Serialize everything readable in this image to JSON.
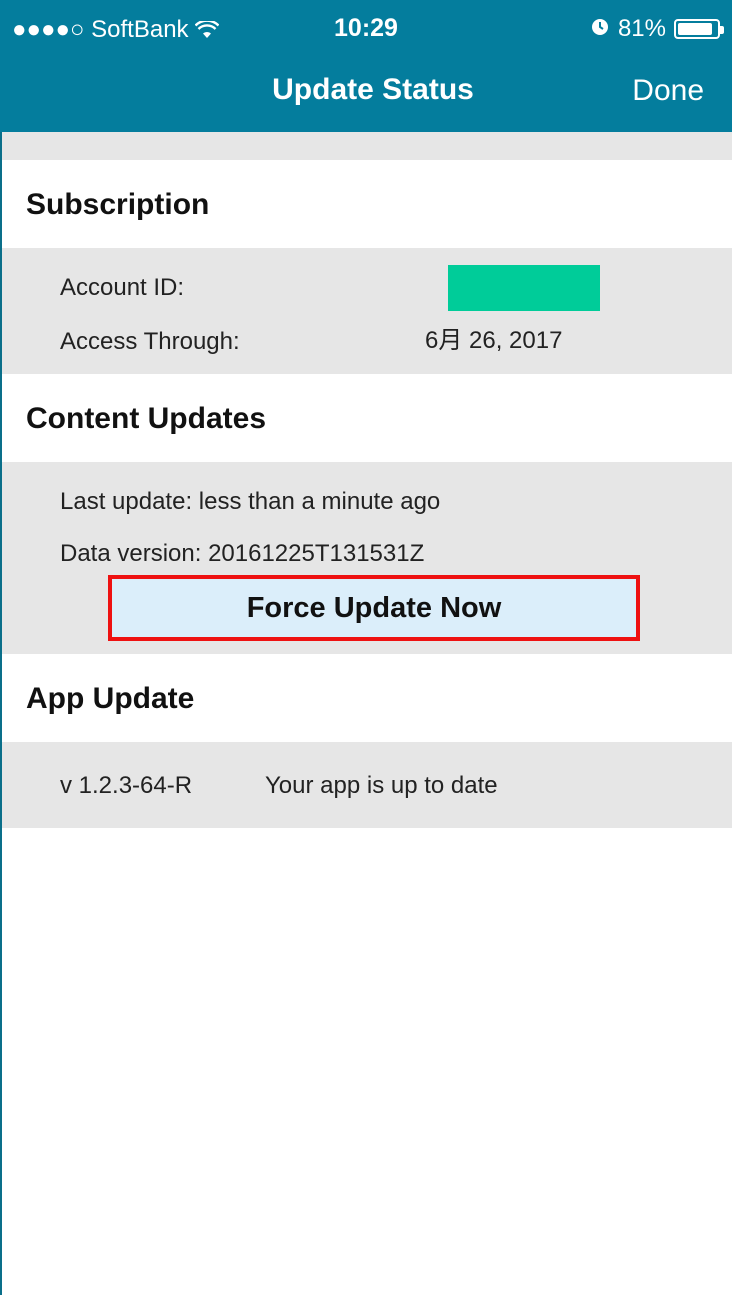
{
  "status_bar": {
    "signal": "●●●●○",
    "carrier": "SoftBank",
    "wifi_icon": "wifi-icon",
    "time": "10:29",
    "alarm_icon": "alarm-icon",
    "battery": "81%"
  },
  "nav": {
    "title": "Update Status",
    "done_label": "Done"
  },
  "subscription": {
    "heading": "Subscription",
    "account_id_label": "Account ID:",
    "access_through_label": "Access Through:",
    "access_through_value": "6月 26, 2017",
    "redaction_color": "#00cc99"
  },
  "content_updates": {
    "heading": "Content Updates",
    "last_update": "Last update: less than a minute ago",
    "data_version": "Data version: 20161225T131531Z",
    "force_button_label": "Force Update Now"
  },
  "app_update": {
    "heading": "App Update",
    "version": "v 1.2.3-64-R",
    "status": "Your app is up to date"
  },
  "colors": {
    "accent": "#047d9d",
    "highlight_border": "#ee1111",
    "button_bg": "#dbeefa"
  }
}
